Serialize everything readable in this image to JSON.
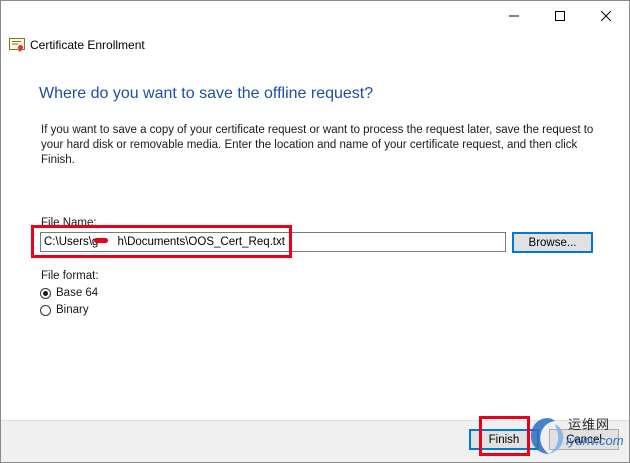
{
  "window": {
    "app_title": "Certificate Enrollment",
    "controls": {
      "minimize": "minimize-icon",
      "maximize": "maximize-icon",
      "close": "close-icon"
    }
  },
  "page": {
    "heading": "Where do you want to save the offline request?",
    "description": "If you want to save a copy of your certificate request or want to process the request later, save the request to your hard disk or removable media. Enter the location and name of your certificate request, and then click Finish."
  },
  "file_name": {
    "label": "File Name:",
    "value": "C:\\Users\\g      h\\Documents\\OOS_Cert_Req.txt",
    "browse_label": "Browse..."
  },
  "file_format": {
    "label": "File format:",
    "options": [
      {
        "label": "Base 64",
        "checked": true
      },
      {
        "label": "Binary",
        "checked": false
      }
    ]
  },
  "footer": {
    "finish_label": "Finish",
    "cancel_label": "Cancel"
  },
  "watermark": {
    "text_cn": "运维网",
    "url": "iyunv.com"
  },
  "colors": {
    "heading": "#1f4fa0",
    "highlight": "#e8001c",
    "default_button": "#0078d7"
  }
}
